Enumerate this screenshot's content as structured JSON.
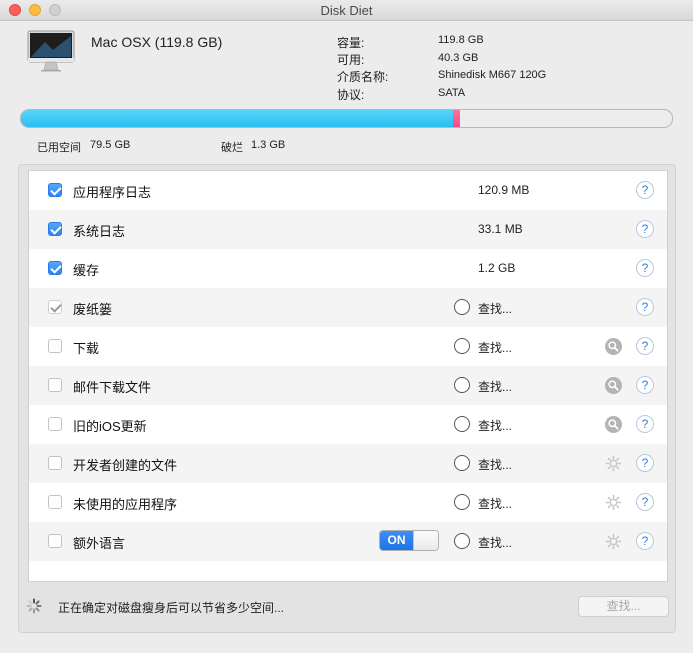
{
  "window": {
    "title": "Disk Diet"
  },
  "disk": {
    "name": "Mac OSX (119.8 GB)",
    "info": [
      {
        "label": "容量:",
        "value": "119.8 GB"
      },
      {
        "label": "可用:",
        "value": "40.3 GB"
      },
      {
        "label": "介质名称:",
        "value": "Shinedisk M667 120G"
      },
      {
        "label": "协议:",
        "value": "SATA"
      }
    ]
  },
  "usage": {
    "used_fraction": 0.6636,
    "junk_fraction": 0.0109,
    "used_label": "已用空间",
    "used_value": "79.5 GB",
    "junk_label": "破烂",
    "junk_value": "1.3 GB"
  },
  "colors": {
    "used": "#27c0f2",
    "junk": "#f04e88",
    "accent": "#2f84f3"
  },
  "items": [
    {
      "label": "应用程序日志",
      "checked": true,
      "size": "120.9 MB",
      "help": "?"
    },
    {
      "label": "系统日志",
      "checked": true,
      "size": "33.1 MB",
      "help": "?"
    },
    {
      "label": "缓存",
      "checked": true,
      "size": "1.2 GB",
      "help": "?"
    },
    {
      "label": "废纸篓",
      "checked": true,
      "disabled": true,
      "find": "查找...",
      "help": "?"
    },
    {
      "label": "下载",
      "checked": false,
      "find": "查找...",
      "action_icon": "magnifier-icon",
      "help": "?"
    },
    {
      "label": "邮件下载文件",
      "checked": false,
      "find": "查找...",
      "action_icon": "magnifier-icon",
      "help": "?"
    },
    {
      "label": "旧的iOS更新",
      "checked": false,
      "find": "查找...",
      "action_icon": "magnifier-icon",
      "help": "?"
    },
    {
      "label": "开发者创建的文件",
      "checked": false,
      "find": "查找...",
      "action_icon": "gear-icon",
      "help": "?"
    },
    {
      "label": "未使用的应用程序",
      "checked": false,
      "find": "查找...",
      "action_icon": "gear-icon",
      "help": "?"
    },
    {
      "label": "额外语言",
      "checked": false,
      "find": "查找...",
      "action_icon": "gear-icon",
      "toggle": "ON",
      "help": "?"
    }
  ],
  "footer": {
    "status": "正在确定对磁盘瘦身后可以节省多少空间...",
    "find_button": "查找..."
  }
}
